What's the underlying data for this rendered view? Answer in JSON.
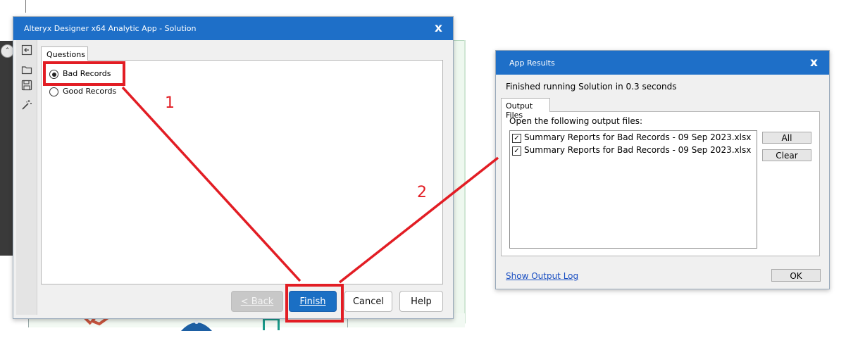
{
  "wizard": {
    "title": "Alteryx Designer x64 Analytic App - Solution",
    "close_glyph": "x",
    "tab_label": "Questions",
    "options": [
      {
        "label": "Bad Records",
        "selected": true
      },
      {
        "label": "Good Records",
        "selected": false
      }
    ],
    "buttons": {
      "back": "< Back",
      "finish": "Finish",
      "cancel": "Cancel",
      "help": "Help"
    },
    "toolbar_icons": [
      "back-arrow-icon",
      "folder-icon",
      "save-icon",
      "magic-wand-icon"
    ]
  },
  "results": {
    "title": "App Results",
    "close_glyph": "x",
    "status": "Finished running Solution in 0.3 seconds",
    "tab_label": "Output Files",
    "instruction": "Open the following output files:",
    "files": [
      {
        "label": "Summary Reports for Bad Records - 09 Sep 2023.xlsx",
        "checked": true
      },
      {
        "label": "Summary Reports for Bad Records - 09 Sep 2023.xlsx",
        "checked": true
      }
    ],
    "buttons": {
      "all": "All",
      "clear": "Clear",
      "ok": "OK"
    },
    "log_link": "Show Output Log"
  },
  "annotations": {
    "step1": "1",
    "step2": "2",
    "color": "#e21d24"
  },
  "colors": {
    "titlebar": "#1e6fc8",
    "finish_button": "#1a6fc4"
  }
}
